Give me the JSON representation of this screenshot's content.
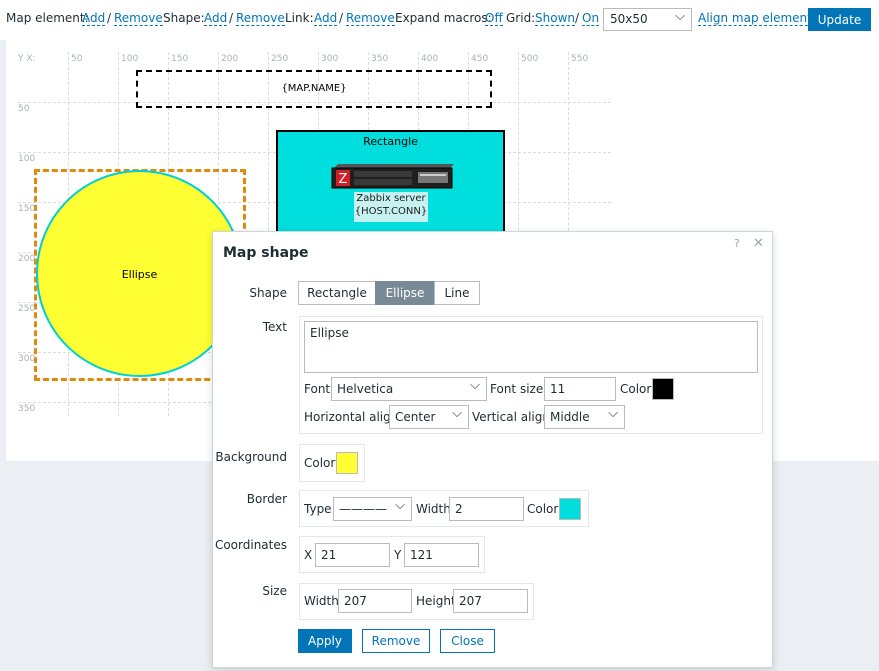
{
  "toolbar": {
    "map_element_label": "Map element:",
    "shape_label": "Shape:",
    "link_label": "Link:",
    "add": "Add",
    "remove": "Remove",
    "slash": "/",
    "expand_macros_label": "Expand macros:",
    "expand_macros_value": "Off",
    "grid_label": "Grid:",
    "grid_shown": "Shown",
    "grid_on": "On",
    "grid_size": "50x50",
    "align_label": "Align map elements",
    "update_label": "Update"
  },
  "map": {
    "axis_label": "Y X:",
    "x_ticks": [
      "50",
      "100",
      "150",
      "200",
      "250",
      "300",
      "350",
      "400",
      "450",
      "500",
      "550"
    ],
    "y_ticks": [
      "50",
      "100",
      "150",
      "200",
      "250",
      "300",
      "350"
    ],
    "map_name": "{MAP.NAME}",
    "rectangle_label": "Rectangle",
    "rectangle_color": "#00dede",
    "host_name": "Zabbix server",
    "host_conn": "{HOST.CONN}",
    "ellipse_label": "Ellipse",
    "ellipse_color": "#ffff33",
    "ellipse_border_color": "#00cfd6",
    "selection_color": "#e08a0b"
  },
  "dialog": {
    "title": "Map shape",
    "help": "?",
    "close": "✕",
    "shape_label": "Shape",
    "shape_options": [
      "Rectangle",
      "Ellipse",
      "Line"
    ],
    "shape_selected": "Ellipse",
    "text_label": "Text",
    "text_value": "Ellipse",
    "font_label": "Font",
    "font_value": "Helvetica",
    "font_size_label": "Font size",
    "font_size_value": "11",
    "color_label": "Color",
    "text_color": "#000000",
    "halign_label": "Horizontal align",
    "halign_value": "Center",
    "valign_label": "Vertical align",
    "valign_value": "Middle",
    "background_label": "Background",
    "background_color": "#ffff33",
    "border_label": "Border",
    "type_label": "Type",
    "border_type_value": "————",
    "width_label": "Width",
    "border_width_value": "2",
    "border_color": "#00dede",
    "coordinates_label": "Coordinates",
    "x_label": "X",
    "x_value": "21",
    "y_label": "Y",
    "y_value": "121",
    "size_label": "Size",
    "height_label": "Height",
    "size_width_value": "207",
    "size_height_value": "207",
    "apply_label": "Apply",
    "remove_label": "Remove",
    "close_label": "Close"
  }
}
